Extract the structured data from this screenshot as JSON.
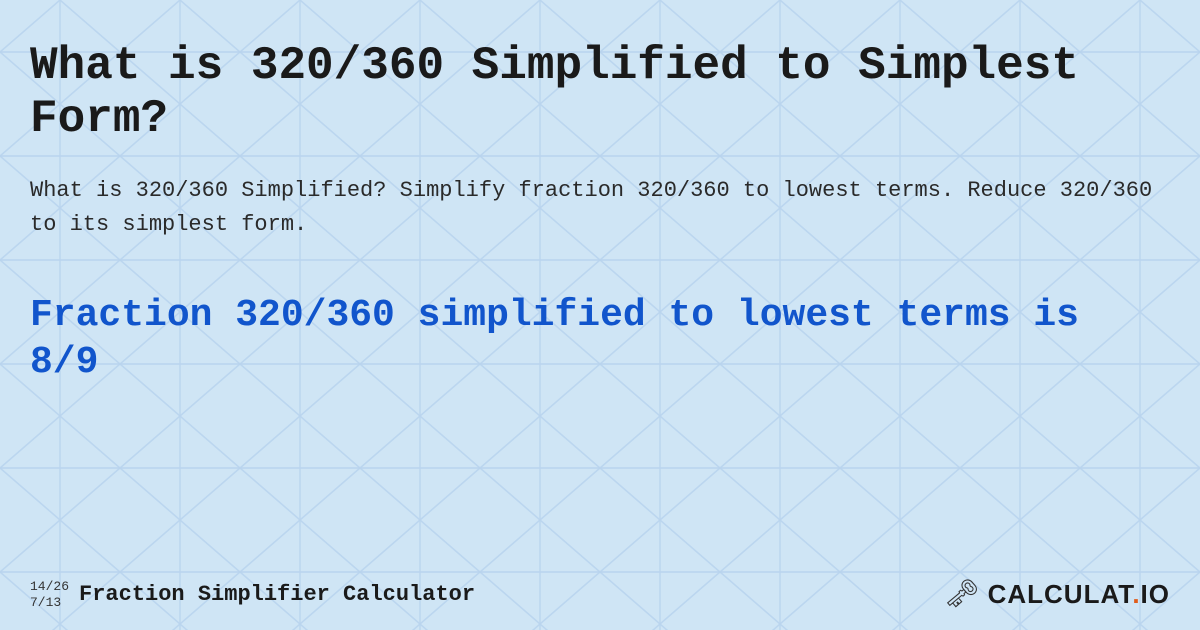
{
  "background": {
    "color": "#cde0f3"
  },
  "main_title": "What is 320/360 Simplified to Simplest Form?",
  "description": "What is 320/360 Simplified? Simplify fraction 320/360 to lowest terms. Reduce 320/360 to its simplest form.",
  "result": "Fraction 320/360 simplified to lowest terms is 8/9",
  "footer": {
    "fraction1": "14/26",
    "fraction2": "7/13",
    "label": "Fraction Simplifier Calculator",
    "logo": "CALCULAT.IO"
  }
}
